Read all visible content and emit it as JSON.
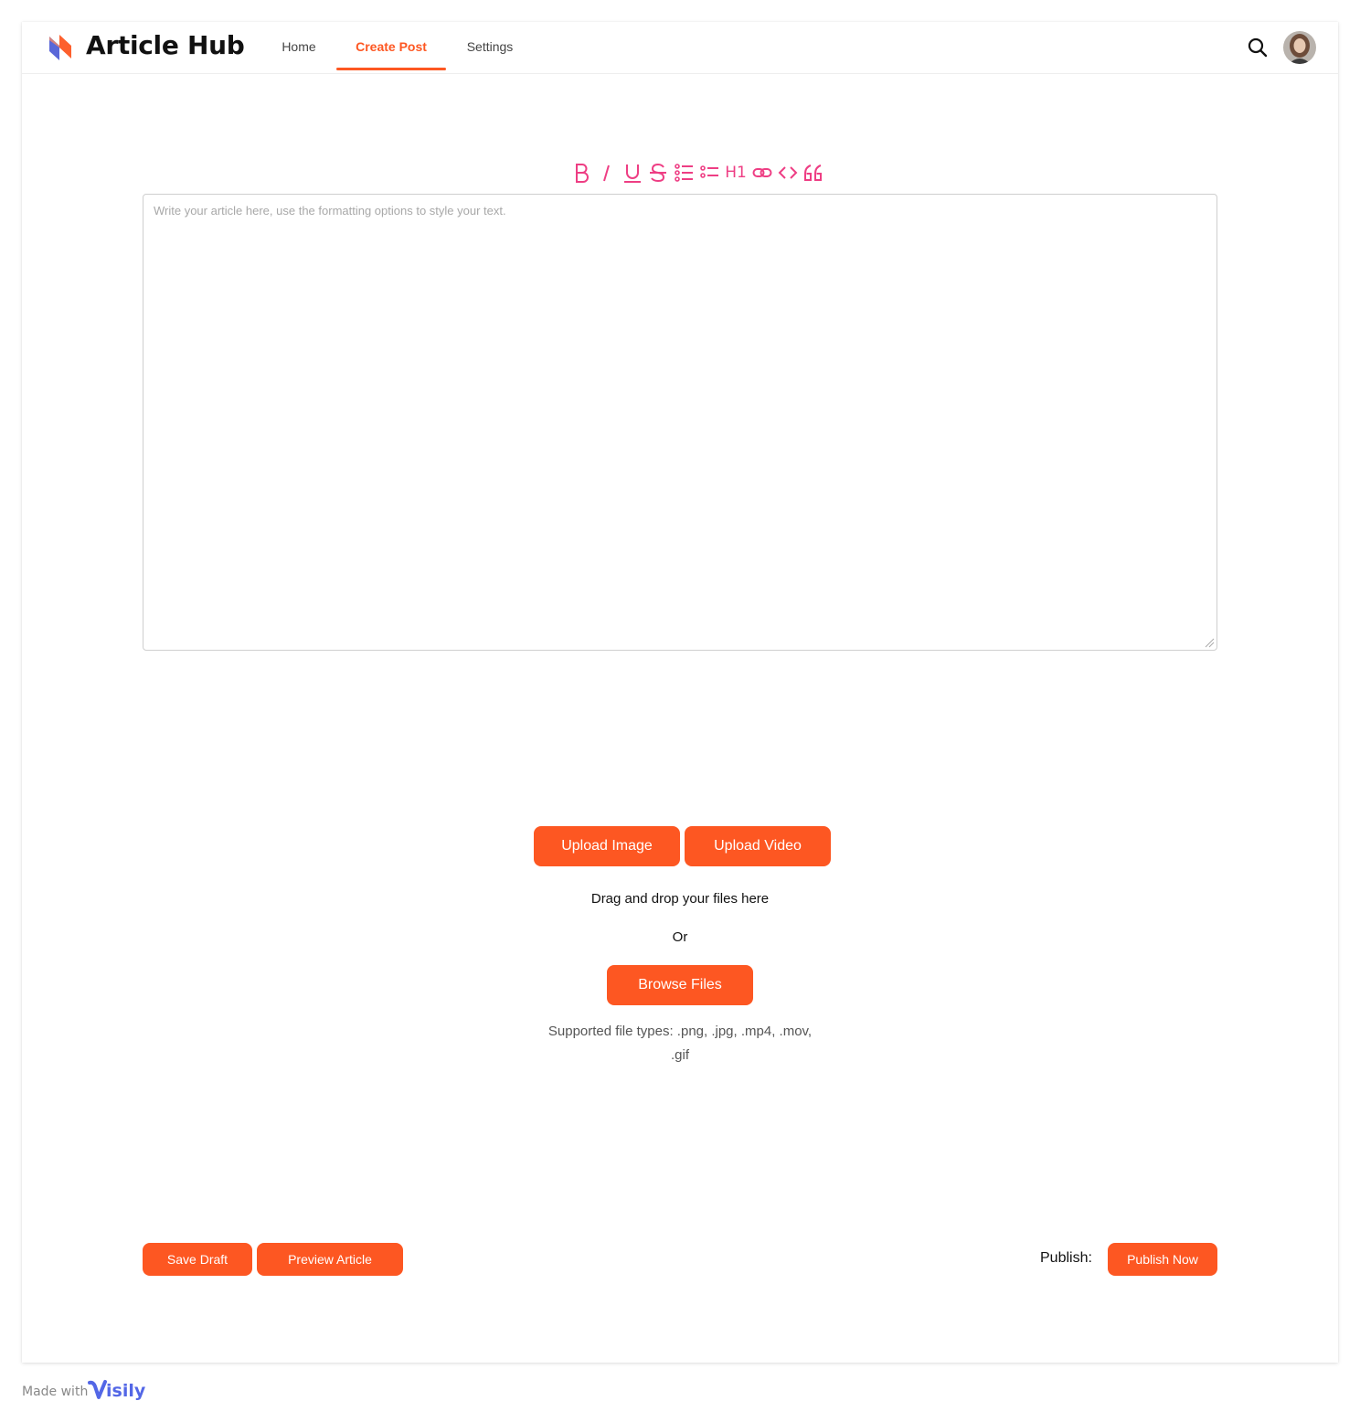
{
  "app": {
    "title": "Article Hub"
  },
  "nav": {
    "items": [
      {
        "label": "Home"
      },
      {
        "label": "Create Post"
      },
      {
        "label": "Settings"
      }
    ],
    "active": "Create Post"
  },
  "header_icons": [
    "search-icon",
    "user-avatar"
  ],
  "toolbar": {
    "tools": [
      "bold-icon",
      "italic-icon",
      "underline-icon",
      "strikethrough-icon",
      "bullet-list-icon",
      "bullet-list-alt-icon",
      "heading-icon",
      "link-icon",
      "code-icon",
      "quote-icon"
    ],
    "heading_label": "H1"
  },
  "editor": {
    "placeholder": "Write your article here, use the formatting options to style your text.",
    "value": ""
  },
  "upload": {
    "upload_image_label": "Upload Image",
    "upload_video_label": "Upload Video",
    "drag_text": "Drag and drop your files here",
    "or_text": "Or",
    "browse_label": "Browse Files",
    "supported_line1": "Supported file types: .png, .jpg, .mp4, .mov,",
    "supported_line2": ".gif"
  },
  "actions": {
    "save_draft_label": "Save Draft",
    "preview_label": "Preview Article",
    "publish_label": "Publish:",
    "publish_now_label": "Publish Now"
  },
  "footer": {
    "made_with": "Made with",
    "brand": "isily"
  },
  "colors": {
    "accent": "#fd5722",
    "toolbar_icons": "#ee3e84",
    "brand_blue": "#5367e6"
  }
}
